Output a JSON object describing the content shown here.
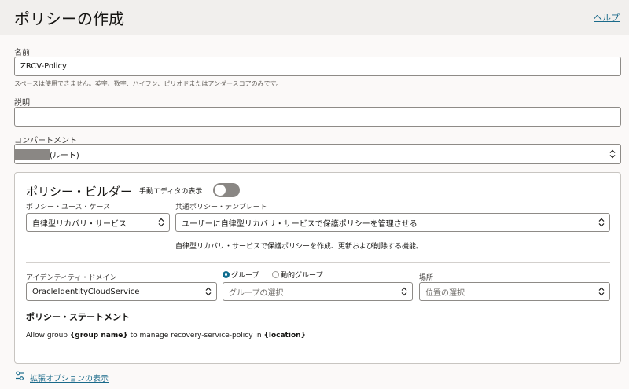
{
  "header": {
    "title": "ポリシーの作成",
    "help": "ヘルプ"
  },
  "name_field": {
    "label": "名前",
    "value": "ZRCV-Policy",
    "hint": "スペースは使用できません。英字、数字、ハイフン、ピリオドまたはアンダースコアのみです。"
  },
  "description_field": {
    "label": "説明",
    "value": ""
  },
  "compartment_field": {
    "label": "コンパートメント",
    "value": "(ルート)"
  },
  "builder": {
    "title": "ポリシー・ビルダー",
    "manual_editor_label": "手動エディタの表示",
    "manual_editor_on": false,
    "use_case_label": "ポリシー・ユース・ケース",
    "use_case_value": "自律型リカバリ・サービス",
    "template_label": "共通ポリシー・テンプレート",
    "template_value": "ユーザーに自律型リカバリ・サービスで保護ポリシーを管理させる",
    "template_description": "自律型リカバリ・サービスで保護ポリシーを作成、更新および削除する機能。",
    "domain_label": "アイデンティティ・ドメイン",
    "domain_value": "OracleIdentityCloudService",
    "radio_group": "グループ",
    "radio_dynamic": "動的グループ",
    "group_placeholder": "グループの選択",
    "location_label": "場所",
    "location_placeholder": "位置の選択",
    "statement_title": "ポリシー・ステートメント",
    "statement": {
      "p1": "Allow group ",
      "group": "{group name}",
      "p2": " to manage recovery-service-policy in ",
      "location": "{location}"
    }
  },
  "advanced_link": "拡張オプションの表示",
  "colors": {
    "accent": "#0f6c8e",
    "link": "#1a6a8a",
    "header_bg": "#f1efed",
    "toggle_off": "#8a8784"
  },
  "icons": {
    "select": "up-down-chevron-icon",
    "advanced": "sliders-icon"
  }
}
